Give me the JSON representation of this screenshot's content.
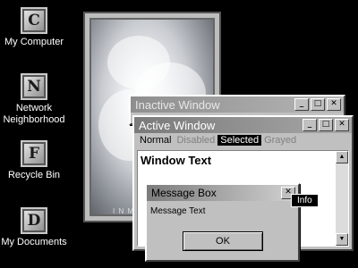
{
  "desktop": {
    "icons": [
      {
        "letter": "C",
        "label": "My Computer"
      },
      {
        "letter": "N",
        "label": "Network Neighborhood"
      },
      {
        "letter": "F",
        "label": "Recycle Bin"
      },
      {
        "letter": "D",
        "label": "My Documents"
      }
    ],
    "wallpaper_caption": "I N M"
  },
  "inactive_window": {
    "title": "Inactive Window",
    "buttons": {
      "minimize": "_",
      "maximize": "□",
      "close": "✕"
    }
  },
  "active_window": {
    "title": "Active Window",
    "buttons": {
      "minimize": "_",
      "maximize": "□",
      "close": "✕"
    },
    "menu": {
      "normal": "Normal",
      "disabled": "Disabled",
      "selected": "Selected",
      "grayed": "Grayed"
    },
    "window_text": "Window Text",
    "scroll_up": "▲",
    "scroll_down": "▼"
  },
  "message_box": {
    "title": "Message Box",
    "close": "✕",
    "text": "Message Text",
    "ok_label": "OK"
  },
  "tooltip": {
    "text": "Info"
  }
}
